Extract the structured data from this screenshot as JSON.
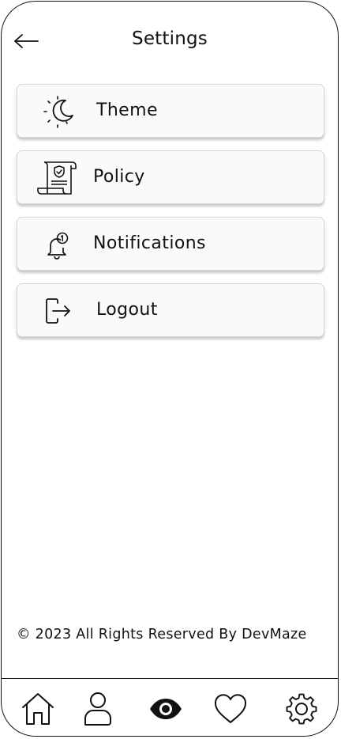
{
  "header": {
    "title": "Settings",
    "back_icon": "arrow-left-icon"
  },
  "menu": [
    {
      "label": "Theme",
      "icon": "moon-sun-icon"
    },
    {
      "label": "Policy",
      "icon": "policy-scroll-icon"
    },
    {
      "label": "Notifications",
      "icon": "bell-notification-icon"
    },
    {
      "label": "Logout",
      "icon": "logout-icon"
    }
  ],
  "footer": {
    "copyright": "© 2023 All Rights Reserved By DevMaze"
  },
  "nav": [
    {
      "name": "home",
      "icon": "home-icon"
    },
    {
      "name": "profile",
      "icon": "user-icon"
    },
    {
      "name": "view",
      "icon": "eye-icon"
    },
    {
      "name": "favorites",
      "icon": "heart-icon"
    },
    {
      "name": "settings",
      "icon": "gear-icon"
    }
  ],
  "colors": {
    "ink": "#111111",
    "card_bg": "#fafafa",
    "card_border": "#d9d9d9"
  }
}
